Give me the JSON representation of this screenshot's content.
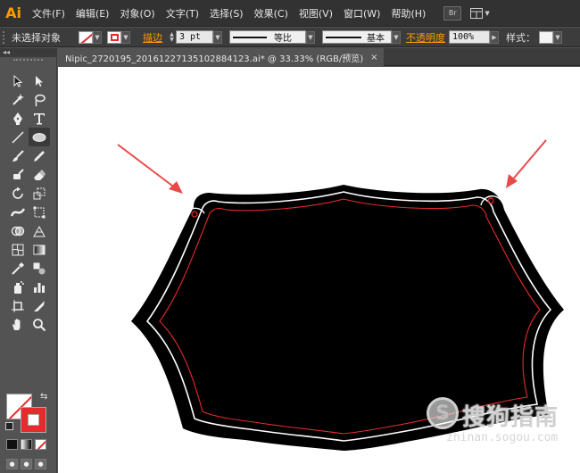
{
  "app": {
    "logo": "Ai"
  },
  "menu": [
    "文件(F)",
    "编辑(E)",
    "对象(O)",
    "文字(T)",
    "选择(S)",
    "效果(C)",
    "视图(V)",
    "窗口(W)",
    "帮助(H)"
  ],
  "menu_right": {
    "bridge_label": "Br"
  },
  "control": {
    "selection_status": "未选择对象",
    "stroke_label": "描边",
    "stroke_weight": "3 pt",
    "profile_label": "等比",
    "brush_label": "基本",
    "opacity_label": "不透明度",
    "opacity_value": "100%",
    "style_label": "样式："
  },
  "document": {
    "tab_title": "Nipic_2720195_20161227135102884123.ai*  @ 33.33% (RGB/预览)",
    "close_glyph": "×"
  },
  "toolbar": {
    "collapse_glyph": "◂◂"
  },
  "colors": {
    "accent": "#ff9a00",
    "fill": "none",
    "stroke": "#e52b2b",
    "shape": "#000000",
    "inner_red": "#e52b2b",
    "inner_white": "#ffffff",
    "arrow": "#e84a4a"
  },
  "watermark": {
    "logo_letter": "S",
    "name": "搜狗指南",
    "url": "zhinan.sogou.com"
  }
}
